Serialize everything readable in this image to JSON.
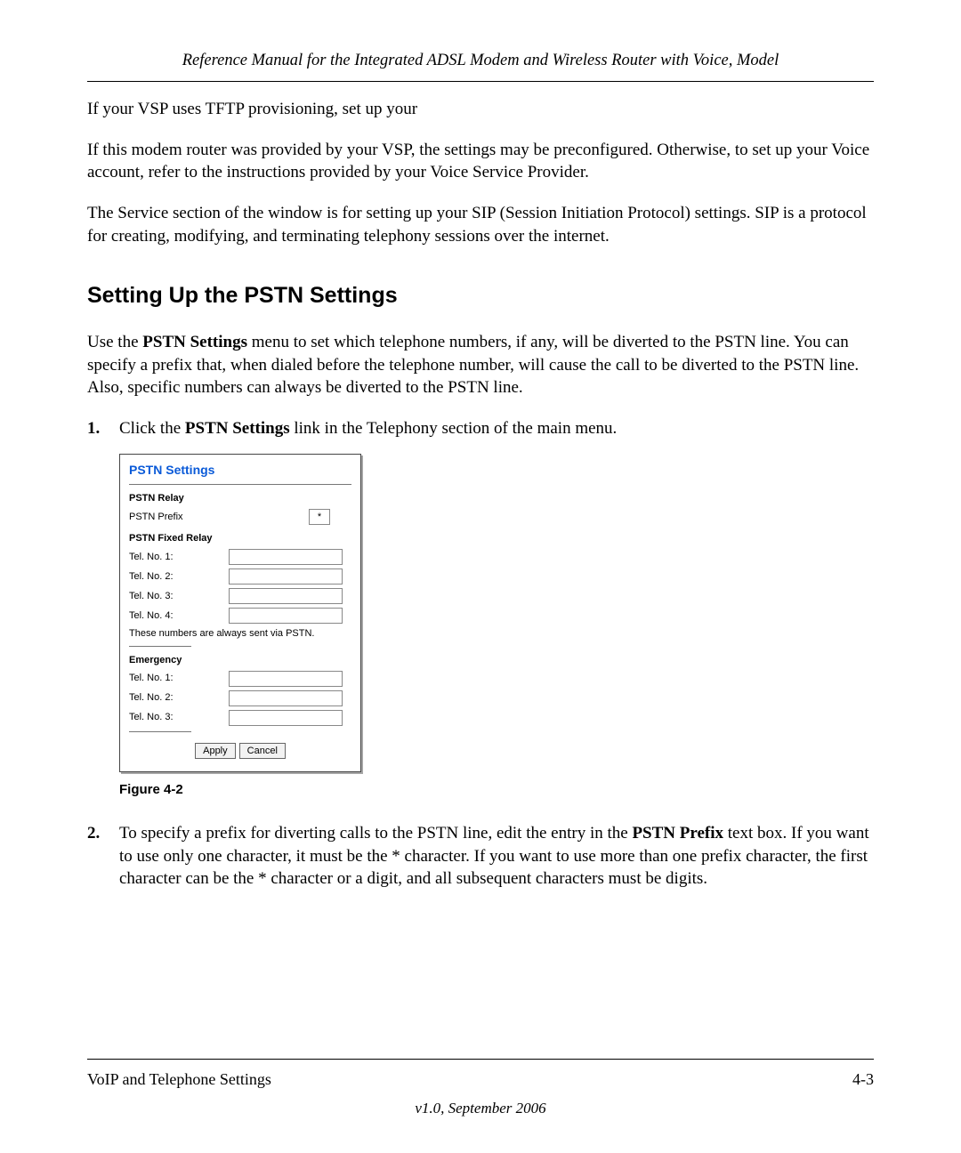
{
  "header": {
    "title": "Reference Manual for the Integrated ADSL Modem and Wireless Router with Voice, Model"
  },
  "body": {
    "p1": "If your VSP uses TFTP provisioning, set up your",
    "p2": "If this modem router was provided by your VSP, the settings may be preconfigured. Otherwise, to set up your Voice account, refer to the instructions provided by your Voice Service Provider.",
    "p3": "The Service section of the window is for setting up your SIP (Session Initiation Protocol) settings. SIP is a protocol for creating, modifying, and terminating telephony sessions over the internet.",
    "section_title": "Setting Up the PSTN Settings",
    "intro_pre": "Use the ",
    "intro_bold": "PSTN Settings",
    "intro_post": " menu to set which telephone numbers, if any, will be diverted to the PSTN line. You can specify a prefix that, when dialed before the telephone number, will cause the call to be diverted to the PSTN line. Also, specific numbers can always be diverted to the PSTN line.",
    "step1": {
      "num": "1.",
      "pre": "Click the ",
      "bold": "PSTN Settings",
      "post": " link in the Telephony section of the main menu."
    },
    "figure_caption": "Figure 4-2",
    "step2": {
      "num": "2.",
      "pre": "To specify a prefix for diverting calls to the PSTN line, edit the entry in the ",
      "bold": "PSTN Prefix",
      "post": " text box. If you want to use only one character, it must be the * character. If you want to use more than one prefix character, the first character can be the * character or a digit, and all subsequent characters must be digits."
    }
  },
  "pstn_panel": {
    "title": "PSTN Settings",
    "relay_header": "PSTN Relay",
    "prefix_label": "PSTN Prefix",
    "prefix_value": "*",
    "fixed_relay_header": "PSTN Fixed Relay",
    "tel1": "Tel. No. 1:",
    "tel2": "Tel. No. 2:",
    "tel3": "Tel. No. 3:",
    "tel4": "Tel. No. 4:",
    "note": "These numbers are always sent via PSTN.",
    "emergency_header": "Emergency",
    "apply": "Apply",
    "cancel": "Cancel"
  },
  "footer": {
    "left": "VoIP and Telephone Settings",
    "right": "4-3",
    "version": "v1.0, September 2006"
  }
}
